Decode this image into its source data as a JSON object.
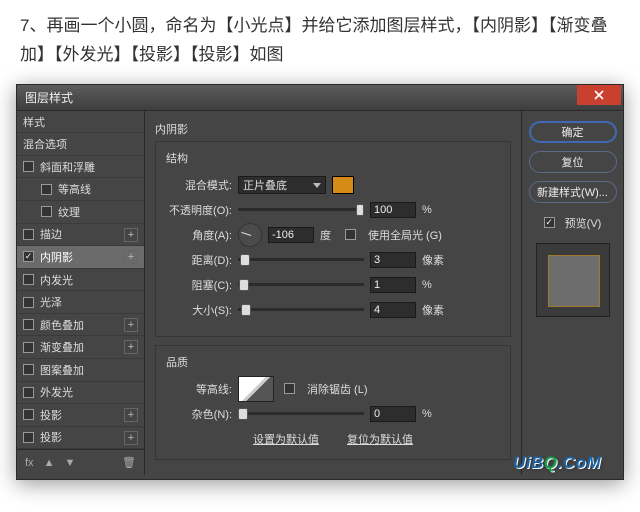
{
  "step_text": "7、再画一个小圆，命名为【小光点】并给它添加图层样式，【内阴影】【渐变叠加】【外发光】【投影】【投影】如图",
  "dialog": {
    "title": "图层样式"
  },
  "sidebar": {
    "heading_styles": "样式",
    "heading_blend": "混合选项",
    "bevel": "斜面和浮雕",
    "contour": "等高线",
    "texture": "纹理",
    "stroke": "描边",
    "inner_shadow": "内阴影",
    "inner_glow": "内发光",
    "satin": "光泽",
    "color_overlay": "颜色叠加",
    "gradient_overlay": "渐变叠加",
    "pattern_overlay": "图案叠加",
    "outer_glow": "外发光",
    "drop_shadow1": "投影",
    "drop_shadow2": "投影",
    "footer_fx": "fx"
  },
  "panel": {
    "title": "内阴影",
    "group_structure": "结构",
    "blend_mode_label": "混合模式:",
    "blend_mode_value": "正片叠底",
    "swatch_color": "#d68b17",
    "opacity_label": "不透明度(O):",
    "opacity_value": "100",
    "percent": "%",
    "angle_label": "角度(A):",
    "angle_value": "-106",
    "degree": "度",
    "global_light": "使用全局光 (G)",
    "distance_label": "距离(D):",
    "distance_value": "3",
    "px": "像素",
    "choke_label": "阻塞(C):",
    "choke_value": "1",
    "size_label": "大小(S):",
    "size_value": "4",
    "group_quality": "品质",
    "contour_label": "等高线:",
    "antialias": "消除锯齿 (L)",
    "noise_label": "杂色(N):",
    "noise_value": "0",
    "make_default": "设置为默认值",
    "reset_default": "复位为默认值"
  },
  "right": {
    "ok": "确定",
    "cancel": "复位",
    "new_style": "新建样式(W)...",
    "preview": "预览(V)"
  },
  "watermark": {
    "a": "UiB",
    "b": "Q",
    "c": ".CoM"
  }
}
